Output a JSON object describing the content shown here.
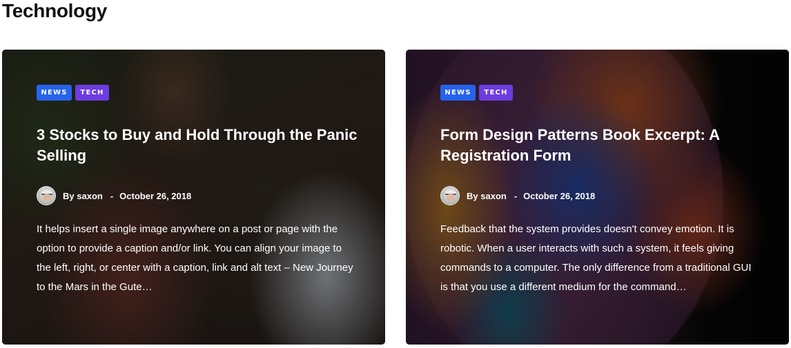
{
  "section": {
    "title": "Technology"
  },
  "colors": {
    "tag_news": "#2563eb",
    "tag_tech": "#6d3ce0",
    "text": "#ffffff",
    "heading": "#111111"
  },
  "cards": [
    {
      "tags": [
        "NEWS",
        "TECH"
      ],
      "title": "3 Stocks to Buy and Hold Through the Panic Selling",
      "by_label": "By",
      "author": "saxon",
      "separator": "-",
      "date": "October 26, 2018",
      "excerpt": "It helps insert a single image anywhere on a post or page with the option to provide a caption and/or link. You can align your image to the left, right, or center with a caption, link and alt text – New Journey to the Mars in the Gute…"
    },
    {
      "tags": [
        "NEWS",
        "TECH"
      ],
      "title": "Form Design Patterns Book Excerpt: A Registration Form",
      "by_label": "By",
      "author": "saxon",
      "separator": "-",
      "date": "October 26, 2018",
      "excerpt": "Feedback that the system provides doesn't convey emotion. It is robotic. When a user interacts with such a system, it feels giving commands to a computer. The only difference from a traditional GUI is that you use a different medium for the command…"
    }
  ]
}
